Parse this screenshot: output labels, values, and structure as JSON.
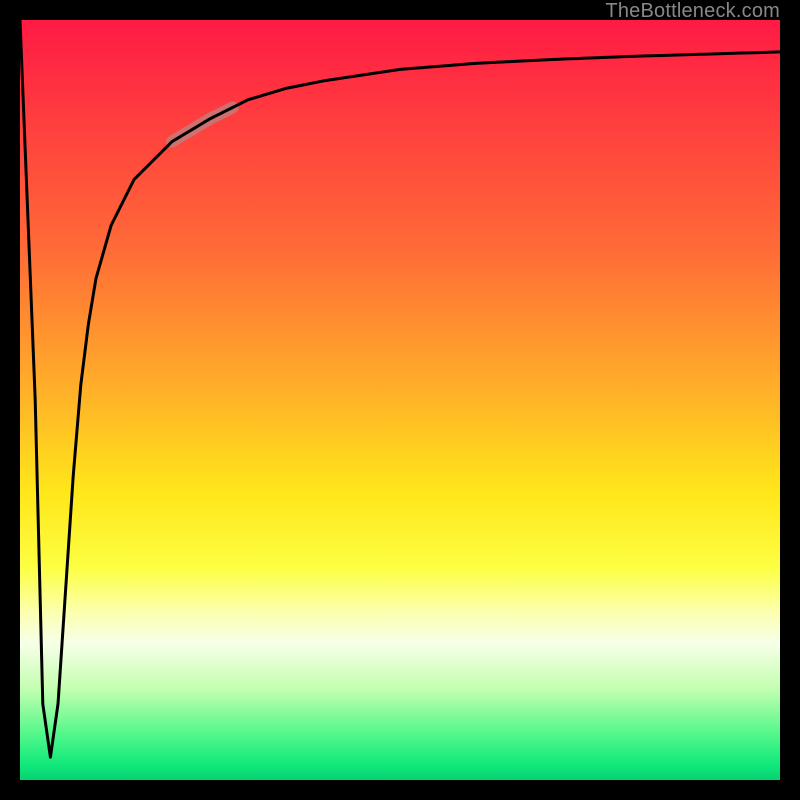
{
  "attribution": "TheBottleneck.com",
  "colors": {
    "frame": "#000000",
    "gradient_top": "#ff1a44",
    "gradient_mid": "#ffe61a",
    "gradient_bottom": "#06d373",
    "curve": "#000000",
    "highlight": "rgba(190,130,130,0.75)"
  },
  "chart_data": {
    "type": "line",
    "title": "",
    "xlabel": "",
    "ylabel": "",
    "xlim": [
      0,
      100
    ],
    "ylim": [
      0,
      100
    ],
    "series": [
      {
        "name": "bottleneck-curve",
        "x": [
          0,
          2,
          3,
          4,
          5,
          6,
          7,
          8,
          9,
          10,
          12,
          15,
          20,
          25,
          30,
          35,
          40,
          50,
          60,
          70,
          80,
          90,
          100
        ],
        "y": [
          100,
          50,
          10,
          3,
          10,
          25,
          40,
          52,
          60,
          66,
          73,
          79,
          84,
          87,
          89.5,
          91,
          92,
          93.5,
          94.3,
          94.8,
          95.2,
          95.5,
          95.8
        ]
      }
    ],
    "highlight_segment": {
      "x_start": 20,
      "x_end": 28
    },
    "annotations": []
  }
}
